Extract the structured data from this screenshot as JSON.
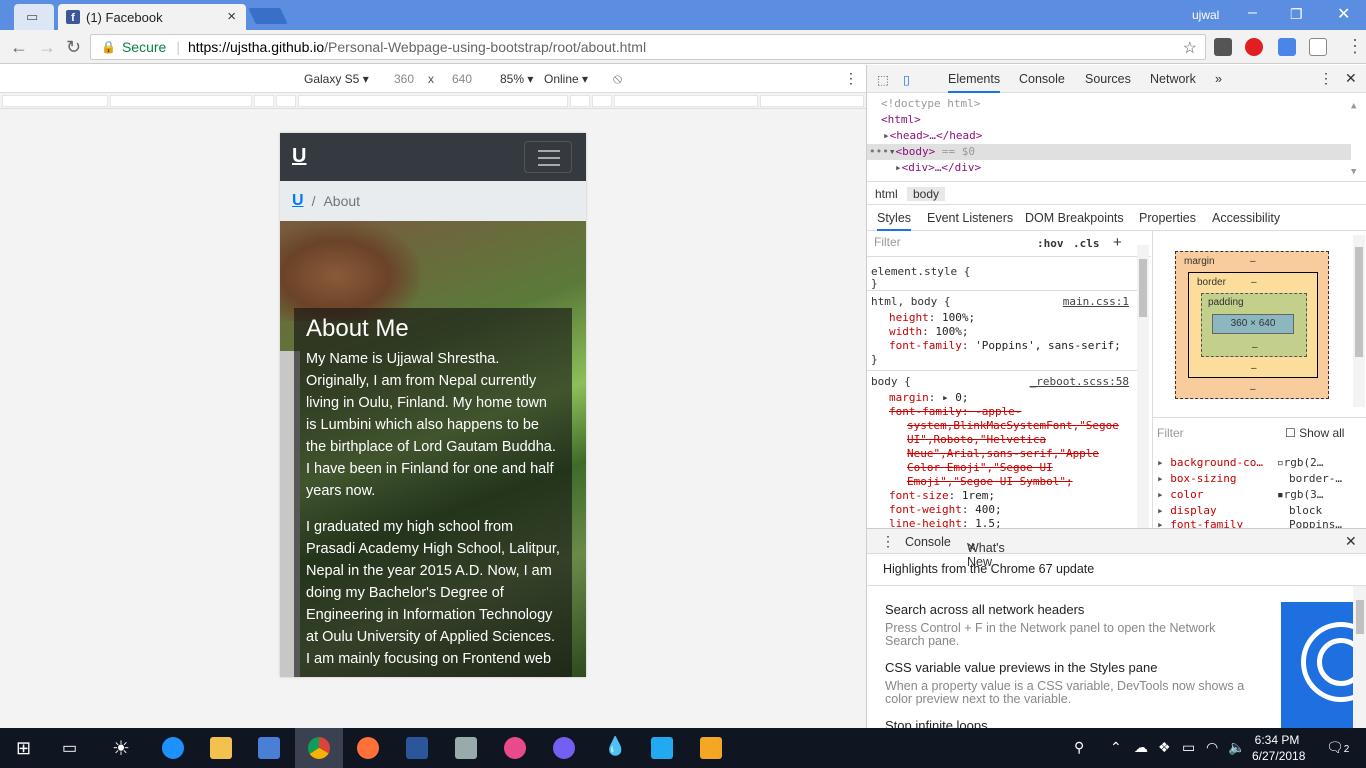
{
  "browser": {
    "tabs": [
      {
        "label": "(1) Facebook"
      }
    ],
    "user": "ujwal",
    "secure_label": "Secure",
    "url_host": "https://ujstha.github.io",
    "url_path": "/Personal-Webpage-using-bootstrap/root/about.html"
  },
  "device_toolbar": {
    "device": "Galaxy S5",
    "width": "360",
    "times": "x",
    "height": "640",
    "zoom": "85%",
    "network": "Online"
  },
  "page": {
    "brand": "U",
    "breadcrumb": {
      "home": "U",
      "separator": "/",
      "current": "About"
    },
    "about_title": "About Me",
    "paragraphs": [
      "My Name is Ujjawal Shrestha. Originally, I am from Nepal currently living in Oulu, Finland. My home town is Lumbini which also happens to be the birthplace of Lord Gautam Buddha. I have been in Finland for one and half years now.",
      "I graduated my high school from Prasadi Academy High School, Lalitpur, Nepal in the year 2015 A.D. Now, I am doing my Bachelor's Degree of Engineering in Information Technology at Oulu University of Applied Sciences. I am mainly focusing on Frontend web"
    ]
  },
  "devtools": {
    "tabs": [
      "Elements",
      "Console",
      "Sources",
      "Network"
    ],
    "more": "»",
    "dom": {
      "doctype": "<!doctype html>",
      "html": "<html>",
      "head": "<head>…</head>",
      "body": "<body>",
      "body_eq": "== $0",
      "div": "<div>…</div>",
      "dots": "•••"
    },
    "crumbs": [
      "html",
      "body"
    ],
    "subtabs": [
      "Styles",
      "Event Listeners",
      "DOM Breakpoints",
      "Properties",
      "Accessibility"
    ],
    "filter_placeholder": "Filter",
    "hov": ":hov",
    "cls": ".cls",
    "plus": "+",
    "rules": {
      "element_style": "element.style {",
      "close": "}",
      "html_body_selector": "html, body {",
      "html_body_src": "main.css:1",
      "html_body_props": [
        {
          "p": "height",
          "v": "100%;"
        },
        {
          "p": "width",
          "v": "100%;"
        },
        {
          "p": "font-family",
          "v": "'Poppins', sans-serif;"
        }
      ],
      "body_selector": "body {",
      "body_src": "_reboot.scss:58",
      "margin": "margin",
      "margin_val": "0;",
      "ff_strike_1": "font-family: -apple-",
      "ff_strike_2": "system,BlinkMacSystemFont,\"Segoe",
      "ff_strike_3": "UI\",Roboto,\"Helvetica",
      "ff_strike_4": "Neue\",Arial,sans-serif,\"Apple",
      "ff_strike_5": "Color Emoji\",\"Segoe UI",
      "ff_strike_6": "Emoji\",\"Segoe UI Symbol\";",
      "font_size": "font-size",
      "font_size_val": "1rem;",
      "font_weight": "font-weight",
      "font_weight_val": "400;",
      "line_height": "line-height",
      "line_height_val": "1.5;"
    },
    "box_model": {
      "margin": "margin",
      "border": "border",
      "padding": "padding",
      "dash": "–",
      "content": "360 × 640"
    },
    "computed_filter": "Filter",
    "show_all": "Show all",
    "computed": [
      {
        "p": "background-co…",
        "v": "rgb(2…"
      },
      {
        "p": "box-sizing",
        "v": "border-…"
      },
      {
        "p": "color",
        "v": "rgb(3…"
      },
      {
        "p": "display",
        "v": "block"
      },
      {
        "p": "font-family",
        "v": "Poppins…"
      }
    ],
    "drawer_tabs": [
      "Console",
      "What's New"
    ],
    "whats_new_header": "Highlights from the Chrome 67 update",
    "whats_new": [
      {
        "title": "Search across all network headers",
        "desc": "Press Control + F in the Network panel to open the Network Search pane."
      },
      {
        "title": "CSS variable value previews in the Styles pane",
        "desc": "When a property value is a CSS variable, DevTools now shows a color preview next to the variable."
      },
      {
        "title": "Stop infinite loops",
        "desc": ""
      }
    ]
  },
  "taskbar": {
    "time": "6:34 PM",
    "date": "6/27/2018",
    "notifications": "2"
  },
  "colors": {
    "accent": "#1a73e8",
    "navbar": "#343a40",
    "link": "#007bff"
  }
}
